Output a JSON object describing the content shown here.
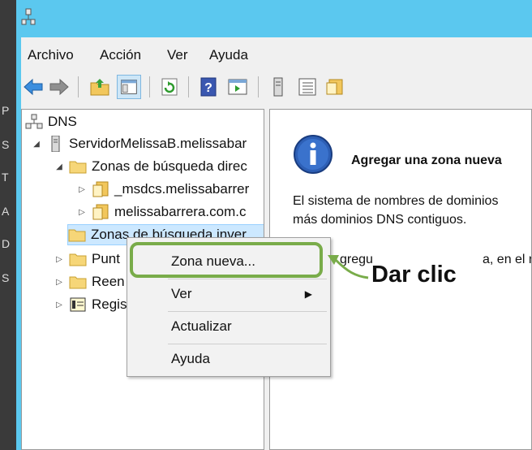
{
  "menubar": {
    "items": [
      "Archivo",
      "Acción",
      "Ver",
      "Ayuda"
    ]
  },
  "tree": {
    "root": "DNS",
    "server": "ServidorMelissaB.melissabar",
    "forward_zones": "Zonas de búsqueda direc",
    "msdcs": "_msdcs.melissabarrer",
    "domain": "melissabarrera.com.c",
    "reverse_zones": "Zonas de búsqueda inver",
    "trust_points": "Punt",
    "forwarders": "Reen",
    "logs": "Regis"
  },
  "wizard": {
    "title": "Agregar una zona nueva",
    "line1": "El sistema de nombres de dominios",
    "line2": "más dominios DNS contiguos.",
    "line3_left": "gregu",
    "line3_right": "a, en el n"
  },
  "context_menu": {
    "items": [
      "Zona nueva...",
      "Ver",
      "Actualizar",
      "Ayuda"
    ]
  },
  "annotation": {
    "label": "Dar clic"
  },
  "colors": {
    "titlebar": "#5bc8ef",
    "highlight": "#79ac4a",
    "selection": "#cce8ff"
  }
}
